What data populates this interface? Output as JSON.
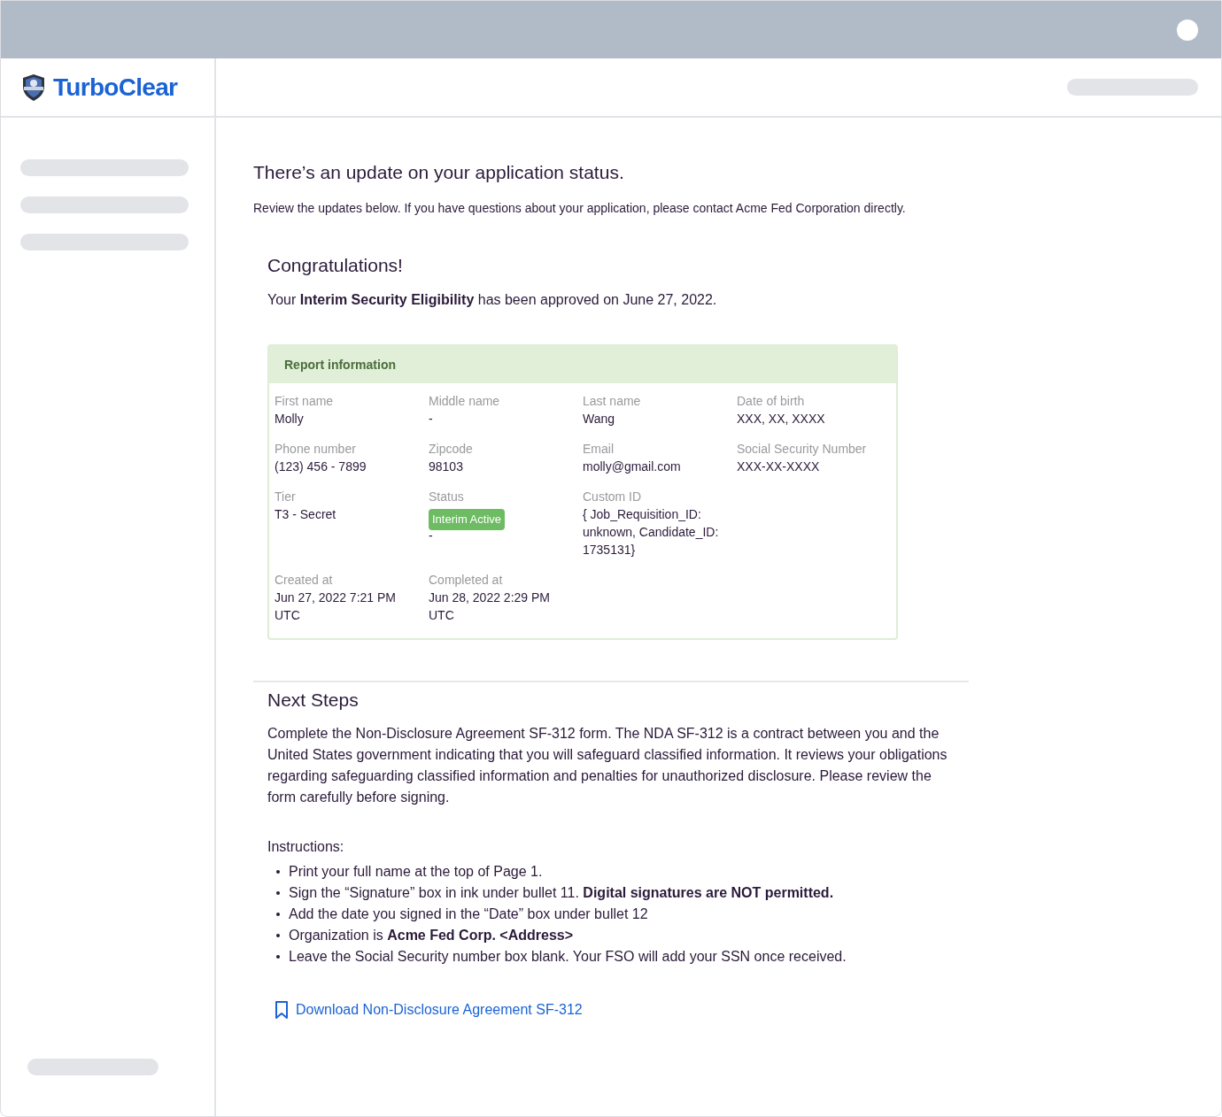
{
  "brand": {
    "name": "TurboClear"
  },
  "heading": "There’s an update on your application status.",
  "intro": "Review the updates below. If you have questions about your application, please contact Acme Fed Corporation directly.",
  "congrats": {
    "title": "Congratulations!",
    "message": "Your **Interim Security Eligibility** has been approved on June 27, 2022."
  },
  "report": {
    "title": "Report information",
    "rows": [
      [
        {
          "label": "First name",
          "value": "Molly"
        },
        {
          "label": "Middle name",
          "value": "-"
        },
        {
          "label": "Last name",
          "value": "Wang"
        },
        {
          "label": "Date of birth",
          "value": "XXX, XX, XXXX"
        }
      ],
      [
        {
          "label": "Phone number",
          "value": "(123) 456 - 7899"
        },
        {
          "label": "Zipcode",
          "value": "98103"
        },
        {
          "label": "Email",
          "value": "molly@gmail.com"
        },
        {
          "label": "Social Security Number",
          "value": "XXX-XX-XXXX"
        }
      ],
      [
        {
          "label": "Tier",
          "value": "T3 - Secret"
        },
        {
          "label": "Status",
          "badge": "Interim Active",
          "value": "-"
        },
        {
          "label": "Custom ID",
          "value": "{ Job_Requisition_ID: unknown, Candidate_ID: 1735131}"
        }
      ],
      [
        {
          "label": "Created at",
          "value": "Jun 27, 2022 7:21 PM UTC"
        },
        {
          "label": "Completed at",
          "value": "Jun 28, 2022 2:29 PM UTC"
        }
      ]
    ]
  },
  "next_steps": {
    "title": "Next Steps",
    "description": "Complete the Non-Disclosure Agreement SF-312 form. The NDA SF-312 is a contract between you and the United States government indicating that you will safeguard classified information. It reviews your obligations regarding safeguarding classified information and penalties for unauthorized disclosure. Please review the form carefully before signing.",
    "instructions_title": "Instructions:",
    "instructions": [
      "Print your full name at the top of Page 1.",
      "Sign the “Signature” box in ink under bullet 11. **Digital signatures are NOT permitted.**",
      "Add the date you signed in the “Date” box under bullet 12",
      "Organization is **Acme Fed Corp. <Address>**",
      "Leave the Social Security number box blank. Your FSO will add your SSN once received."
    ],
    "download_link": "Download Non-Disclosure Agreement SF-312"
  }
}
